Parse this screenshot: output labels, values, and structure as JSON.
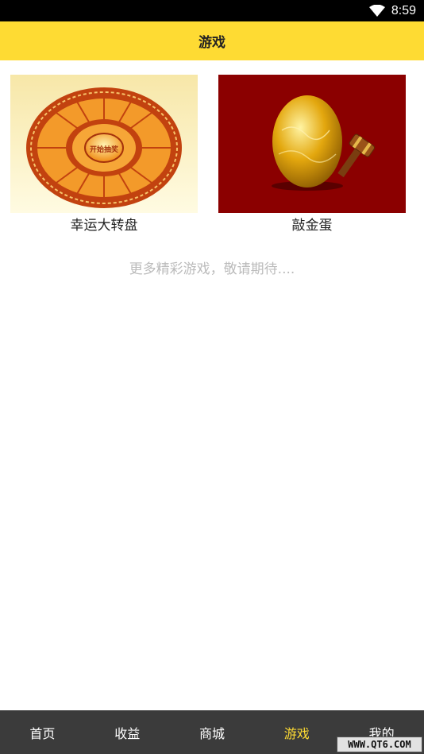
{
  "status_bar": {
    "time": "8:59",
    "wifi_icon": "wifi-icon",
    "battery_icon": "battery-icon"
  },
  "header": {
    "title": "游戏"
  },
  "games": [
    {
      "label": "幸运大转盘",
      "image_icon": "lucky-wheel-image",
      "center_text": "开始抽奖"
    },
    {
      "label": "敲金蛋",
      "image_icon": "golden-egg-image"
    }
  ],
  "more_text": "更多精彩游戏，敬请期待....",
  "tabs": [
    {
      "label": "首页"
    },
    {
      "label": "收益"
    },
    {
      "label": "商城"
    },
    {
      "label": "游戏",
      "active": true
    },
    {
      "label": "我的"
    }
  ],
  "watermark": "WWW.QT6.COM",
  "colors": {
    "accent": "#fedb33",
    "tab_bar": "#3b3b3b",
    "egg_bg": "#8b0000"
  }
}
